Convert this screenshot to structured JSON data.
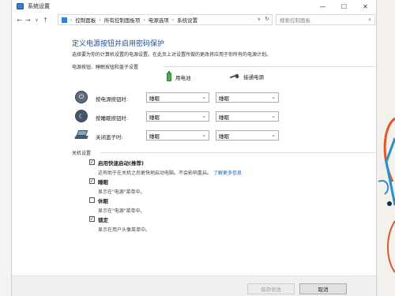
{
  "window": {
    "title": "系统设置",
    "controls": {
      "minimize": "—",
      "maximize": "☐",
      "close": "✕"
    }
  },
  "address": {
    "crumbs": [
      "控制面板",
      "所有控制面板项",
      "电源选项",
      "系统设置"
    ],
    "search_placeholder": "搜索控制面板"
  },
  "main": {
    "title": "定义电源按钮并启用密码保护",
    "intro": "选择要为你的计算机设置的电源设置。在此页上对设置所做的更改将应用于你所有的电源计划。",
    "section_power": "电源按钮、睡眠按钮和盖子设置",
    "col_battery": "用电池",
    "col_plugged": "接通电源",
    "rows": [
      {
        "label": "按电源按钮时:",
        "battery": "睡眠",
        "plugged": "睡眠"
      },
      {
        "label": "按睡眠按钮时:",
        "battery": "睡眠",
        "plugged": "睡眠"
      },
      {
        "label": "关闭盖子时:",
        "battery": "睡眠",
        "plugged": "睡眠"
      }
    ],
    "section_shutdown": "关机设置",
    "checks": [
      {
        "label": "启用快速启动(推荐)",
        "desc": "这有助于在关机之后更快地启动电脑。不会影响重启。",
        "link": "了解更多信息",
        "checked": true
      },
      {
        "label": "睡眠",
        "desc": "显示在\"电源\"菜单中。",
        "checked": true
      },
      {
        "label": "休眠",
        "desc": "显示在\"电源\"菜单中。",
        "checked": false
      },
      {
        "label": "锁定",
        "desc": "显示在用户头像菜单中。",
        "checked": true
      }
    ]
  },
  "footer": {
    "save_label": "保存修改",
    "cancel_label": "取消"
  },
  "colors": {
    "title_blue": "#1e4e9b",
    "link_blue": "#1a5fb4"
  }
}
